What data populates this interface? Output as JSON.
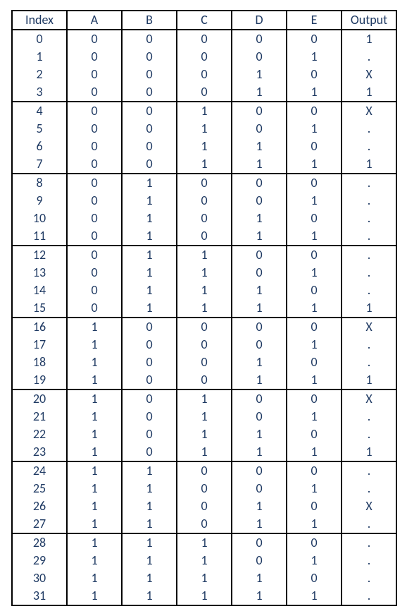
{
  "chart_data": {
    "type": "table",
    "title": "",
    "columns": [
      "Index",
      "A",
      "B",
      "C",
      "D",
      "E",
      "Output"
    ],
    "rows": [
      {
        "Index": "0",
        "A": "0",
        "B": "0",
        "C": "0",
        "D": "0",
        "E": "0",
        "Output": "1"
      },
      {
        "Index": "1",
        "A": "0",
        "B": "0",
        "C": "0",
        "D": "0",
        "E": "1",
        "Output": "."
      },
      {
        "Index": "2",
        "A": "0",
        "B": "0",
        "C": "0",
        "D": "1",
        "E": "0",
        "Output": "X"
      },
      {
        "Index": "3",
        "A": "0",
        "B": "0",
        "C": "0",
        "D": "1",
        "E": "1",
        "Output": "1"
      },
      {
        "Index": "4",
        "A": "0",
        "B": "0",
        "C": "1",
        "D": "0",
        "E": "0",
        "Output": "X"
      },
      {
        "Index": "5",
        "A": "0",
        "B": "0",
        "C": "1",
        "D": "0",
        "E": "1",
        "Output": "."
      },
      {
        "Index": "6",
        "A": "0",
        "B": "0",
        "C": "1",
        "D": "1",
        "E": "0",
        "Output": "."
      },
      {
        "Index": "7",
        "A": "0",
        "B": "0",
        "C": "1",
        "D": "1",
        "E": "1",
        "Output": "1"
      },
      {
        "Index": "8",
        "A": "0",
        "B": "1",
        "C": "0",
        "D": "0",
        "E": "0",
        "Output": "."
      },
      {
        "Index": "9",
        "A": "0",
        "B": "1",
        "C": "0",
        "D": "0",
        "E": "1",
        "Output": "."
      },
      {
        "Index": "10",
        "A": "0",
        "B": "1",
        "C": "0",
        "D": "1",
        "E": "0",
        "Output": "."
      },
      {
        "Index": "11",
        "A": "0",
        "B": "1",
        "C": "0",
        "D": "1",
        "E": "1",
        "Output": "."
      },
      {
        "Index": "12",
        "A": "0",
        "B": "1",
        "C": "1",
        "D": "0",
        "E": "0",
        "Output": "."
      },
      {
        "Index": "13",
        "A": "0",
        "B": "1",
        "C": "1",
        "D": "0",
        "E": "1",
        "Output": "."
      },
      {
        "Index": "14",
        "A": "0",
        "B": "1",
        "C": "1",
        "D": "1",
        "E": "0",
        "Output": "."
      },
      {
        "Index": "15",
        "A": "0",
        "B": "1",
        "C": "1",
        "D": "1",
        "E": "1",
        "Output": "1"
      },
      {
        "Index": "16",
        "A": "1",
        "B": "0",
        "C": "0",
        "D": "0",
        "E": "0",
        "Output": "X"
      },
      {
        "Index": "17",
        "A": "1",
        "B": "0",
        "C": "0",
        "D": "0",
        "E": "1",
        "Output": "."
      },
      {
        "Index": "18",
        "A": "1",
        "B": "0",
        "C": "0",
        "D": "1",
        "E": "0",
        "Output": "."
      },
      {
        "Index": "19",
        "A": "1",
        "B": "0",
        "C": "0",
        "D": "1",
        "E": "1",
        "Output": "1"
      },
      {
        "Index": "20",
        "A": "1",
        "B": "0",
        "C": "1",
        "D": "0",
        "E": "0",
        "Output": "X"
      },
      {
        "Index": "21",
        "A": "1",
        "B": "0",
        "C": "1",
        "D": "0",
        "E": "1",
        "Output": "."
      },
      {
        "Index": "22",
        "A": "1",
        "B": "0",
        "C": "1",
        "D": "1",
        "E": "0",
        "Output": "."
      },
      {
        "Index": "23",
        "A": "1",
        "B": "0",
        "C": "1",
        "D": "1",
        "E": "1",
        "Output": "1"
      },
      {
        "Index": "24",
        "A": "1",
        "B": "1",
        "C": "0",
        "D": "0",
        "E": "0",
        "Output": "."
      },
      {
        "Index": "25",
        "A": "1",
        "B": "1",
        "C": "0",
        "D": "0",
        "E": "1",
        "Output": "."
      },
      {
        "Index": "26",
        "A": "1",
        "B": "1",
        "C": "0",
        "D": "1",
        "E": "0",
        "Output": "X"
      },
      {
        "Index": "27",
        "A": "1",
        "B": "1",
        "C": "0",
        "D": "1",
        "E": "1",
        "Output": "."
      },
      {
        "Index": "28",
        "A": "1",
        "B": "1",
        "C": "1",
        "D": "0",
        "E": "0",
        "Output": "."
      },
      {
        "Index": "29",
        "A": "1",
        "B": "1",
        "C": "1",
        "D": "0",
        "E": "1",
        "Output": "."
      },
      {
        "Index": "30",
        "A": "1",
        "B": "1",
        "C": "1",
        "D": "1",
        "E": "0",
        "Output": "."
      },
      {
        "Index": "31",
        "A": "1",
        "B": "1",
        "C": "1",
        "D": "1",
        "E": "1",
        "Output": "."
      }
    ]
  }
}
